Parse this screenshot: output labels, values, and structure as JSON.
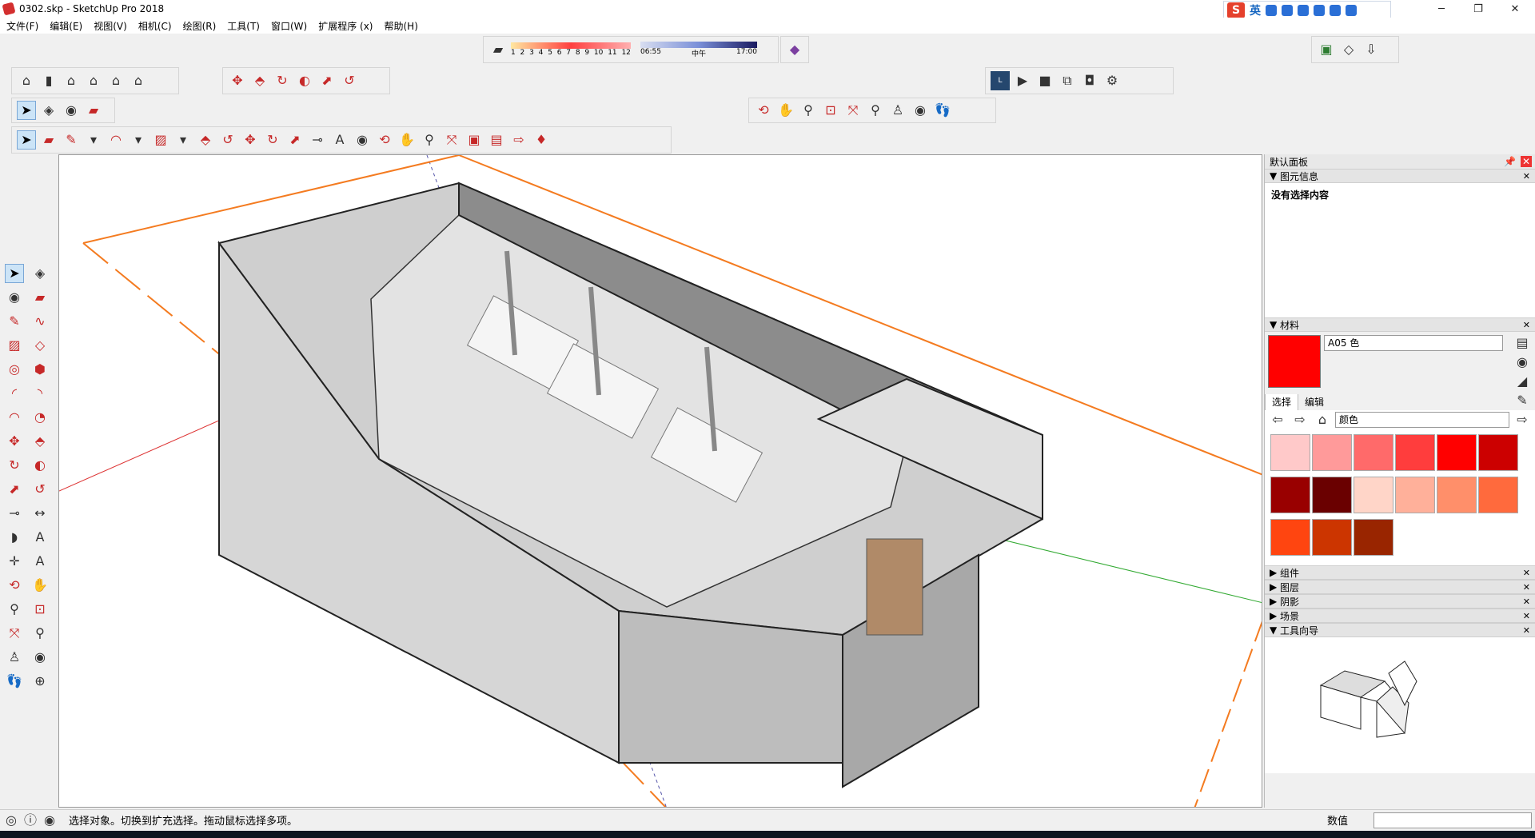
{
  "window": {
    "title": "0302.skp - SketchUp Pro 2018",
    "minimize": "─",
    "maximize": "❐",
    "close": "✕"
  },
  "ime": {
    "logo": "S",
    "mode": "英"
  },
  "menu": [
    "文件(F)",
    "编辑(E)",
    "视图(V)",
    "相机(C)",
    "绘图(R)",
    "工具(T)",
    "窗口(W)",
    "扩展程序 (x)",
    "帮助(H)"
  ],
  "shadow_bar": {
    "months": [
      "1",
      "2",
      "3",
      "4",
      "5",
      "6",
      "7",
      "8",
      "9",
      "10",
      "11",
      "12"
    ],
    "time_start": "06:55",
    "time_mid": "中午",
    "time_end": "17:00"
  },
  "panel": {
    "title": "默认面板",
    "entity_info": {
      "title": "图元信息",
      "text": "没有选择内容"
    },
    "materials": {
      "title": "材料",
      "name": "A05 色",
      "tab_select": "选择",
      "tab_edit": "编辑",
      "library": "颜色",
      "current_color": "#ff0000",
      "swatches": [
        "#ffc9c9",
        "#ff9a9a",
        "#ff6a6a",
        "#ff3d3d",
        "#ff0000",
        "#cc0000",
        "#990000",
        "#6a0000",
        "#ffd5c8",
        "#ffb09a",
        "#ff8f6a",
        "#ff6a3d",
        "#ff4510",
        "#cc3500",
        "#992500"
      ]
    },
    "sections": [
      "组件",
      "图层",
      "阴影",
      "场景"
    ],
    "instructor": {
      "title": "工具向导"
    }
  },
  "status": {
    "message": "选择对象。切换到扩充选择。拖动鼠标选择多项。",
    "value_label": "数值"
  }
}
